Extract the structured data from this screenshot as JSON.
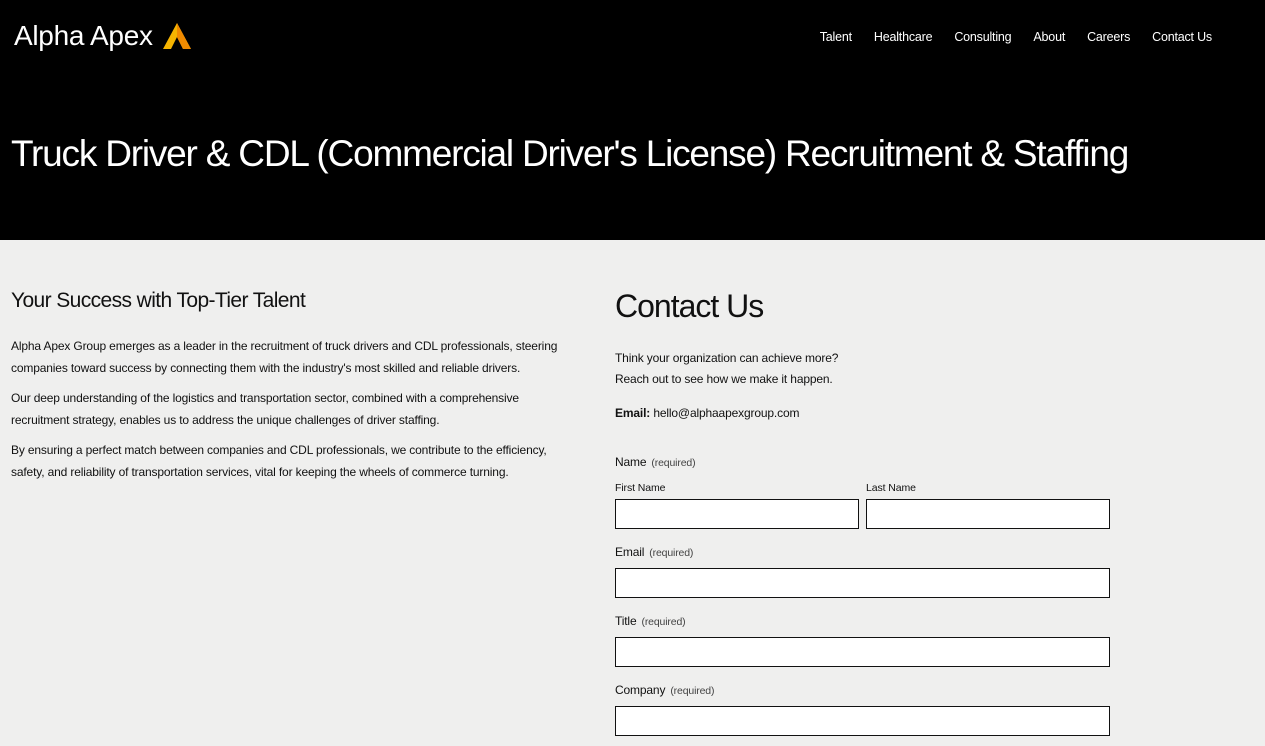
{
  "brand": {
    "name": "Alpha Apex",
    "logo_icon": "apex-triangle-logo",
    "logo_colors": [
      "#f5b400",
      "#f08a00"
    ]
  },
  "nav": [
    {
      "label": "Talent"
    },
    {
      "label": "Healthcare"
    },
    {
      "label": "Consulting"
    },
    {
      "label": "About"
    },
    {
      "label": "Careers"
    },
    {
      "label": "Contact Us"
    }
  ],
  "hero": {
    "title": "Truck Driver & CDL (Commercial Driver's License) Recruitment & Staffing"
  },
  "left": {
    "heading": "Your Success with Top-Tier Talent",
    "paragraphs": [
      "Alpha Apex Group emerges as a leader in the recruitment of truck drivers and CDL professionals, steering companies toward success by connecting them with the industry's most skilled and reliable drivers.",
      "Our deep understanding of the logistics and transportation sector, combined with a comprehensive recruitment strategy, enables us to address the unique challenges of driver staffing.",
      "By ensuring a perfect match between companies and CDL professionals, we contribute to the efficiency, safety, and reliability of transportation services, vital for keeping the wheels of commerce turning."
    ]
  },
  "contact": {
    "heading": "Contact Us",
    "intro_line1": "Think your organization can achieve more?",
    "intro_line2": "Reach out to see how we make it happen.",
    "email_label": "Email:",
    "email_value": "hello@alphaapexgroup.com"
  },
  "form": {
    "required_text": "(required)",
    "name_label": "Name",
    "first_name_label": "First Name",
    "first_name_value": "",
    "last_name_label": "Last Name",
    "last_name_value": "",
    "email_label": "Email",
    "email_value": "",
    "title_label": "Title",
    "title_value": "",
    "company_label": "Company",
    "company_value": ""
  }
}
